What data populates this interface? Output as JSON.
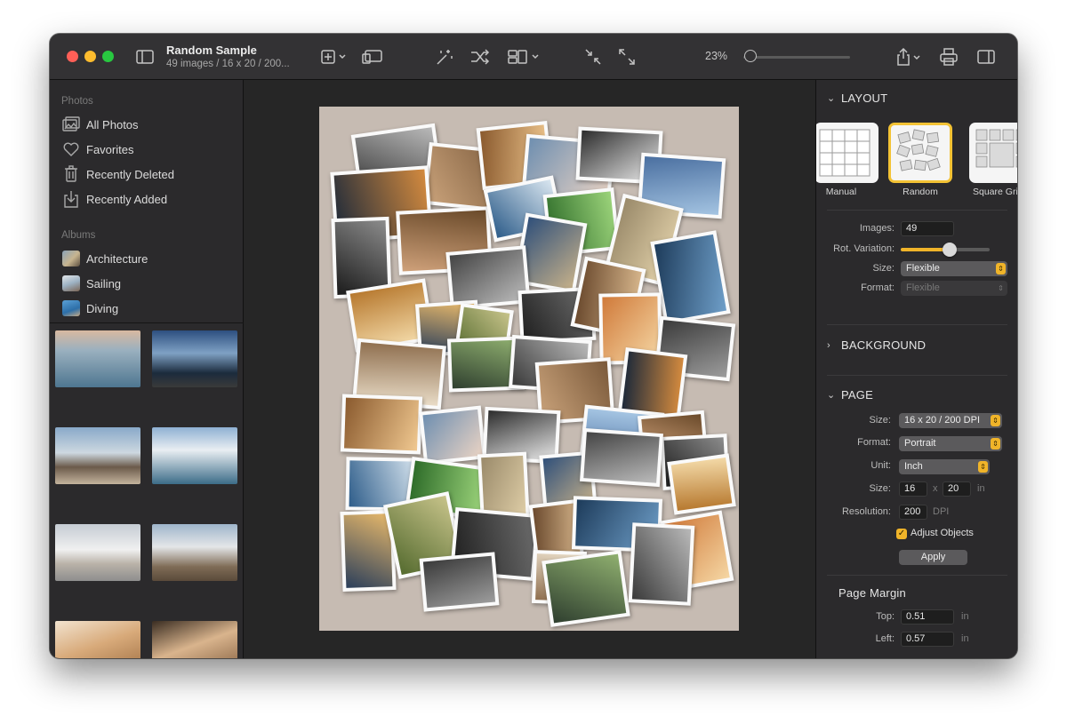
{
  "window": {
    "title": "Random Sample",
    "subtitle": "49 images / 16 x 20 / 200..."
  },
  "toolbar": {
    "zoom_label": "23%",
    "zoom_value": 0.05,
    "icons": [
      "sidebar-toggle-icon",
      "add-icon",
      "slideshow-icon",
      "magic-wand-icon",
      "shuffle-icon",
      "layout-icon",
      "collapse-icon",
      "expand-icon",
      "share-icon",
      "print-icon",
      "inspector-toggle-icon"
    ]
  },
  "sidebar": {
    "photos_header": "Photos",
    "photos_items": [
      {
        "label": "All Photos",
        "icon": "photos-icon"
      },
      {
        "label": "Favorites",
        "icon": "heart-icon"
      },
      {
        "label": "Recently Deleted",
        "icon": "trash-icon"
      },
      {
        "label": "Recently Added",
        "icon": "import-icon"
      }
    ],
    "albums_header": "Albums",
    "albums": [
      {
        "label": "Architecture"
      },
      {
        "label": "Sailing"
      },
      {
        "label": "Diving"
      }
    ]
  },
  "inspector": {
    "layout": {
      "header": "LAYOUT",
      "options": [
        "Manual",
        "Random",
        "Square Grid"
      ],
      "selected": "Random",
      "images_label": "Images:",
      "images_value": "49",
      "rot_label": "Rot. Variation:",
      "rot_value": 0.55,
      "size_label": "Size:",
      "size_value": "Flexible",
      "format_label": "Format:",
      "format_value": "Flexible"
    },
    "background": {
      "header": "BACKGROUND"
    },
    "page": {
      "header": "PAGE",
      "size_label": "Size:",
      "size_value": "16 x 20 / 200 DPI",
      "format_label": "Format:",
      "format_value": "Portrait",
      "unit_label": "Unit:",
      "unit_value": "Inch",
      "dims_label": "Size:",
      "width": "16",
      "x_sep": "x",
      "height": "20",
      "dims_unit": "in",
      "res_label": "Resolution:",
      "res_value": "200",
      "res_unit": "DPI",
      "adjust_label": "Adjust Objects",
      "apply_label": "Apply"
    },
    "margin": {
      "header": "Page Margin",
      "top_label": "Top:",
      "top_value": "0.51",
      "left_label": "Left:",
      "left_value": "0.57",
      "unit": "in"
    }
  },
  "colors": {
    "accent": "#f0b429",
    "page_bg": "#c6bbb2"
  }
}
